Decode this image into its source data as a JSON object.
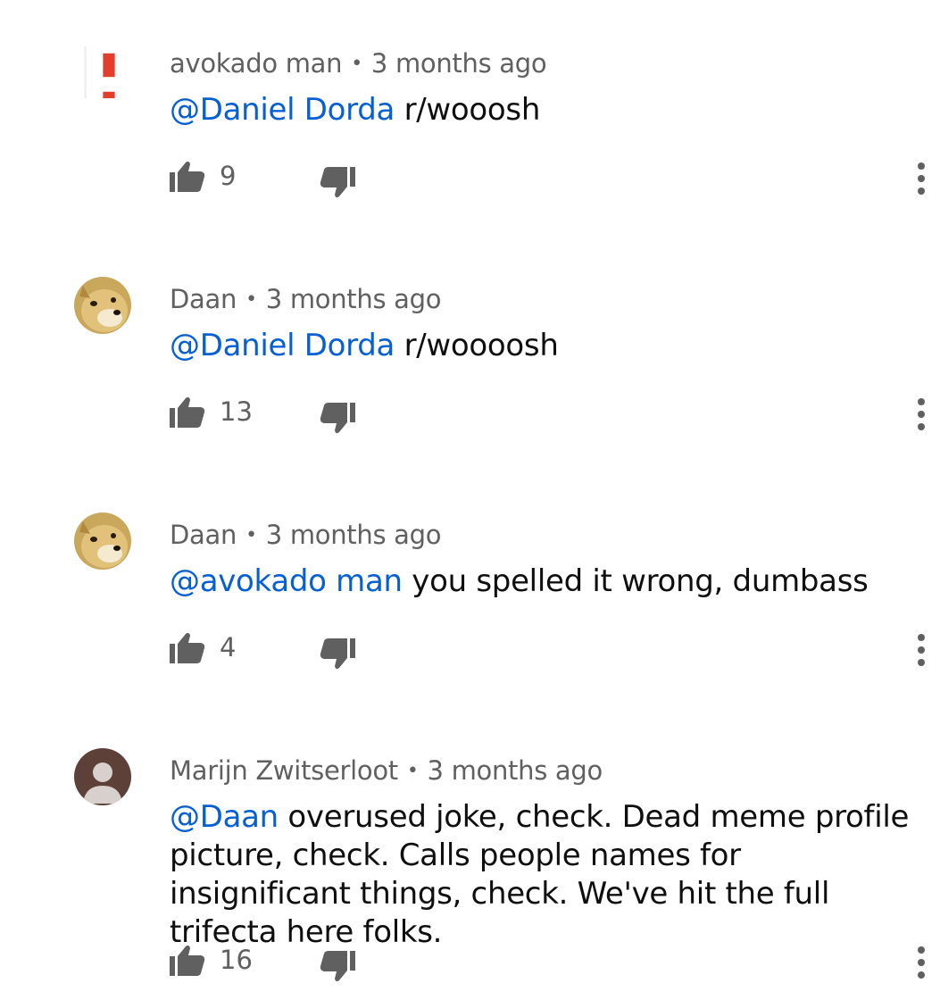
{
  "comments": [
    {
      "author": "avokado man",
      "separator": "•",
      "time": "3 months ago",
      "mention": "@Daniel Dorda",
      "text": " r/wooosh",
      "likes": "9",
      "avatar": "exclamation-icon"
    },
    {
      "author": "Daan",
      "separator": "•",
      "time": "3 months ago",
      "mention": "@Daniel Dorda",
      "text": " r/woooosh",
      "likes": "13",
      "avatar": "doge-icon"
    },
    {
      "author": "Daan",
      "separator": "•",
      "time": "3 months ago",
      "mention": "@avokado man",
      "text": " you spelled it wrong, dumbass",
      "likes": "4",
      "avatar": "doge-icon"
    },
    {
      "author": "Marijn Zwitserloot",
      "separator": "•",
      "time": "3 months ago",
      "mention": "@Daan",
      "text": " overused joke, check. Dead meme profile picture, check. Calls people names for insignificant things, check. We've hit the full trifecta here folks.",
      "likes": "16",
      "avatar": "default-person-icon"
    }
  ],
  "colors": {
    "mention": "#065fd4",
    "meta": "#606060",
    "text": "#0f0f0f",
    "icons": "#606060"
  }
}
